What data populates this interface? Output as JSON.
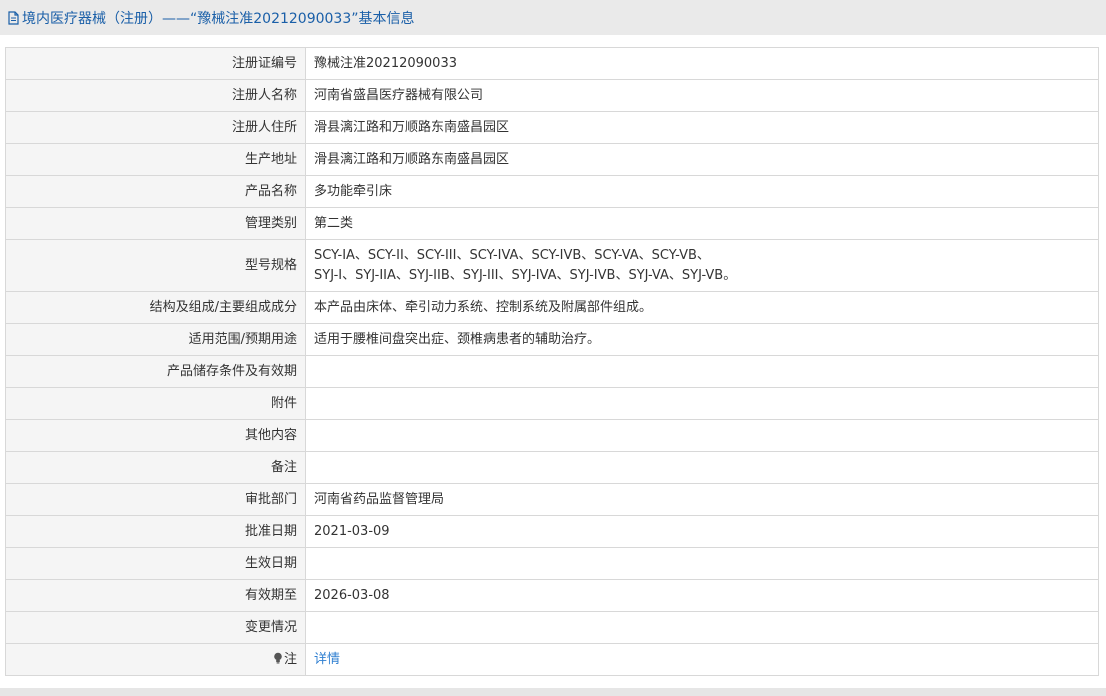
{
  "header": {
    "title": "境内医疗器械（注册）——“豫械注准20212090033”基本信息"
  },
  "rows": [
    {
      "label": "注册证编号",
      "value": "豫械注准20212090033"
    },
    {
      "label": "注册人名称",
      "value": "河南省盛昌医疗器械有限公司"
    },
    {
      "label": "注册人住所",
      "value": "滑县漓江路和万顺路东南盛昌园区"
    },
    {
      "label": "生产地址",
      "value": "滑县漓江路和万顺路东南盛昌园区"
    },
    {
      "label": "产品名称",
      "value": "多功能牵引床"
    },
    {
      "label": "管理类别",
      "value": "第二类"
    },
    {
      "label": "型号规格",
      "value_line1": "SCY-IA、SCY-II、SCY-III、SCY-IVA、SCY-IVB、SCY-VA、SCY-VB、",
      "value_line2": "SYJ-I、SYJ-IIA、SYJ-IIB、SYJ-III、SYJ-IVA、SYJ-IVB、SYJ-VA、SYJ-VB。"
    },
    {
      "label": "结构及组成/主要组成成分",
      "value": "本产品由床体、牵引动力系统、控制系统及附属部件组成。"
    },
    {
      "label": "适用范围/预期用途",
      "value": "适用于腰椎间盘突出症、颈椎病患者的辅助治疗。"
    },
    {
      "label": "产品储存条件及有效期",
      "value": ""
    },
    {
      "label": "附件",
      "value": ""
    },
    {
      "label": "其他内容",
      "value": ""
    },
    {
      "label": "备注",
      "value": ""
    },
    {
      "label": "审批部门",
      "value": "河南省药品监督管理局"
    },
    {
      "label": "批准日期",
      "value": "2021-03-09"
    },
    {
      "label": "生效日期",
      "value": ""
    },
    {
      "label": "有效期至",
      "value": "2026-03-08"
    },
    {
      "label": "变更情况",
      "value": ""
    },
    {
      "label": "注",
      "value": "详情"
    }
  ],
  "icons": {
    "header": "document-icon",
    "note": "bulb-icon"
  },
  "colors": {
    "title": "#1a5fa8",
    "link": "#2f7fd1",
    "label_bg": "#f5f5f5",
    "border": "#d8d8d8"
  }
}
